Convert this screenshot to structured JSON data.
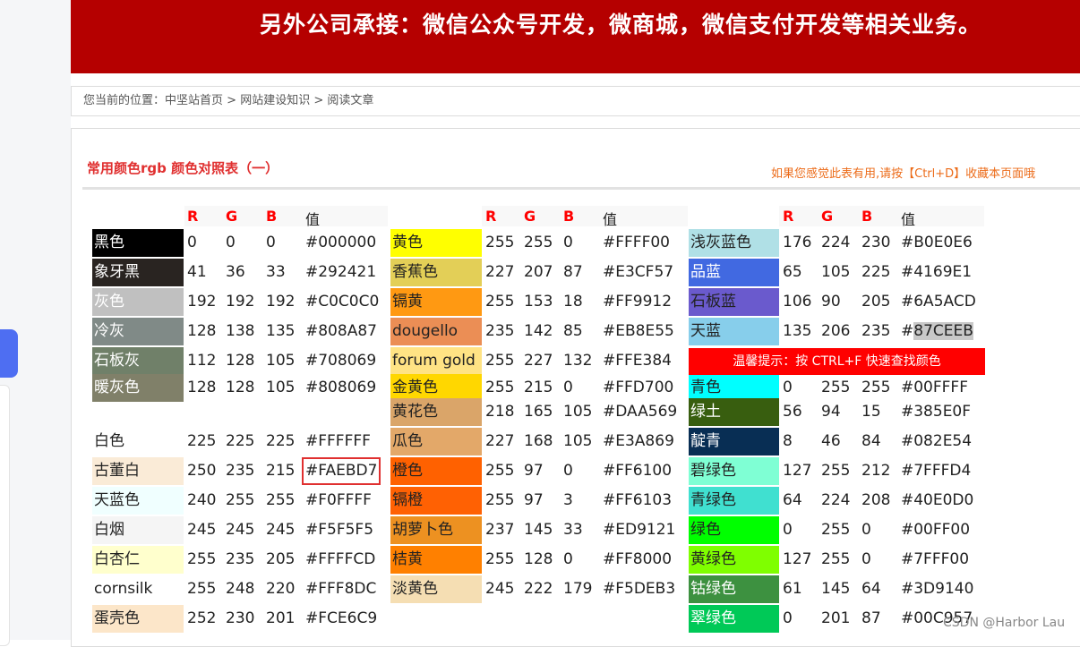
{
  "banner": {
    "text": "另外公司承接：微信公众号开发，微商城，微信支付开发等相关业务。"
  },
  "breadcrumb": {
    "prefix": "您当前的位置：",
    "home": "中坚站首页",
    "sep1": " > ",
    "category": "网站建设知识",
    "sep2": " > ",
    "current": "阅读文章"
  },
  "article": {
    "title": "常用颜色rgb 颜色对照表（一）",
    "bookmark_tip": "如果您感觉此表有用,请按【Ctrl+D】收藏本页面哦"
  },
  "table": {
    "headers": {
      "r": "R",
      "g": "G",
      "b": "B",
      "hex": "值"
    },
    "warm_tip": "温馨提示：按 CTRL+F 快速查找颜色",
    "col1": [
      {
        "name": "黑色",
        "r": "0",
        "g": "0",
        "b": "0",
        "hex": "#000000",
        "swatch": "#000000",
        "text_color": "#ffffff"
      },
      {
        "name": "象牙黑",
        "r": "41",
        "g": "36",
        "b": "33",
        "hex": "#292421",
        "swatch": "#292421",
        "text_color": "#ffffff"
      },
      {
        "name": "灰色",
        "r": "192",
        "g": "192",
        "b": "192",
        "hex": "#C0C0C0",
        "swatch": "#c0c0c0",
        "text_color": "#ffffff"
      },
      {
        "name": "冷灰",
        "r": "128",
        "g": "138",
        "b": "135",
        "hex": "#808A87",
        "swatch": "#808a87",
        "text_color": "#ffffff"
      },
      {
        "name": "石板灰",
        "r": "112",
        "g": "128",
        "b": "105",
        "hex": "#708069",
        "swatch": "#708069",
        "text_color": "#ffffff"
      },
      {
        "name": "暖灰色",
        "r": "128",
        "g": "128",
        "b": "105",
        "hex": "#808069",
        "swatch": "#808069",
        "text_color": "#ffffff"
      },
      {
        "name": "白色",
        "r": "225",
        "g": "225",
        "b": "225",
        "hex": "#FFFFFF",
        "swatch": "#ffffff",
        "text_color": "#222222"
      },
      {
        "name": "古董白",
        "r": "250",
        "g": "235",
        "b": "215",
        "hex": "#FAEBD7",
        "swatch": "#faebd7",
        "text_color": "#222222",
        "boxed": true
      },
      {
        "name": "天蓝色",
        "r": "240",
        "g": "255",
        "b": "255",
        "hex": "#F0FFFF",
        "swatch": "#f0ffff",
        "text_color": "#222222"
      },
      {
        "name": "白烟",
        "r": "245",
        "g": "245",
        "b": "245",
        "hex": "#F5F5F5",
        "swatch": "#f5f5f5",
        "text_color": "#222222"
      },
      {
        "name": "白杏仁",
        "r": "255",
        "g": "235",
        "b": "205",
        "hex": "#FFFFCD",
        "swatch": "#ffffcd",
        "text_color": "#222222"
      },
      {
        "name": "cornsilk",
        "r": "255",
        "g": "248",
        "b": "220",
        "hex": "#FFF8DC",
        "swatch": "#ffffff",
        "text_color": "#222222"
      },
      {
        "name": "蛋壳色",
        "r": "252",
        "g": "230",
        "b": "201",
        "hex": "#FCE6C9",
        "swatch": "#fce6c9",
        "text_color": "#222222"
      }
    ],
    "col2": [
      {
        "name": "黄色",
        "r": "255",
        "g": "255",
        "b": "0",
        "hex": "#FFFF00",
        "swatch": "#ffff00",
        "text_color": "#222222"
      },
      {
        "name": "香蕉色",
        "r": "227",
        "g": "207",
        "b": "87",
        "hex": "#E3CF57",
        "swatch": "#e3cf57",
        "text_color": "#222222"
      },
      {
        "name": "镉黄",
        "r": "255",
        "g": "153",
        "b": "18",
        "hex": "#FF9912",
        "swatch": "#ff9912",
        "text_color": "#222222"
      },
      {
        "name": "dougello",
        "r": "235",
        "g": "142",
        "b": "85",
        "hex": "#EB8E55",
        "swatch": "#eb8e55",
        "text_color": "#222222"
      },
      {
        "name": "forum gold",
        "r": "255",
        "g": "227",
        "b": "132",
        "hex": "#FFE384",
        "swatch": "#ffe384",
        "text_color": "#222222"
      },
      {
        "name": "金黄色",
        "r": "255",
        "g": "215",
        "b": "0",
        "hex": "#FFD700",
        "swatch": "#ffd700",
        "text_color": "#222222"
      },
      {
        "name": "黄花色",
        "r": "218",
        "g": "165",
        "b": "105",
        "hex": "#DAA569",
        "swatch": "#daa569",
        "text_color": "#222222"
      },
      {
        "name": "瓜色",
        "r": "227",
        "g": "168",
        "b": "105",
        "hex": "#E3A869",
        "swatch": "#e3a869",
        "text_color": "#222222"
      },
      {
        "name": "橙色",
        "r": "255",
        "g": "97",
        "b": "0",
        "hex": "#FF6100",
        "swatch": "#ff6100",
        "text_color": "#222222"
      },
      {
        "name": "镉橙",
        "r": "255",
        "g": "97",
        "b": "3",
        "hex": "#FF6103",
        "swatch": "#ff6103",
        "text_color": "#222222"
      },
      {
        "name": "胡萝卜色",
        "r": "237",
        "g": "145",
        "b": "33",
        "hex": "#ED9121",
        "swatch": "#ed9121",
        "text_color": "#222222"
      },
      {
        "name": "桔黄",
        "r": "255",
        "g": "128",
        "b": "0",
        "hex": "#FF8000",
        "swatch": "#ff8000",
        "text_color": "#222222"
      },
      {
        "name": "淡黄色",
        "r": "245",
        "g": "222",
        "b": "179",
        "hex": "#F5DEB3",
        "swatch": "#f5deb3",
        "text_color": "#222222"
      }
    ],
    "col3": [
      {
        "name": "浅灰蓝色",
        "r": "176",
        "g": "224",
        "b": "230",
        "hex": "#B0E0E6",
        "swatch": "#b0e0e6",
        "text_color": "#222222"
      },
      {
        "name": "品蓝",
        "r": "65",
        "g": "105",
        "b": "225",
        "hex": "#4169E1",
        "swatch": "#4169e1",
        "text_color": "#ffffff"
      },
      {
        "name": "石板蓝",
        "r": "106",
        "g": "90",
        "b": "205",
        "hex": "#6A5ACD",
        "swatch": "#6a5acd",
        "text_color": "#222222"
      },
      {
        "name": "天蓝",
        "r": "135",
        "g": "206",
        "b": "235",
        "hex_prefix": "#",
        "hex_rest": "87CEEB",
        "swatch": "#87ceeb",
        "text_color": "#222222"
      },
      {
        "name": "青色",
        "r": "0",
        "g": "255",
        "b": "255",
        "hex": "#00FFFF",
        "swatch": "#00ffff",
        "text_color": "#222222"
      },
      {
        "name": "绿土",
        "r": "56",
        "g": "94",
        "b": "15",
        "hex": "#385E0F",
        "swatch": "#385e0f",
        "text_color": "#ffffff"
      },
      {
        "name": "靛青",
        "r": "8",
        "g": "46",
        "b": "84",
        "hex": "#082E54",
        "swatch": "#082e54",
        "text_color": "#ffffff"
      },
      {
        "name": "碧绿色",
        "r": "127",
        "g": "255",
        "b": "212",
        "hex": "#7FFFD4",
        "swatch": "#7fffd4",
        "text_color": "#222222"
      },
      {
        "name": "青绿色",
        "r": "64",
        "g": "224",
        "b": "208",
        "hex": "#40E0D0",
        "swatch": "#40e0d0",
        "text_color": "#222222"
      },
      {
        "name": "绿色",
        "r": "0",
        "g": "255",
        "b": "0",
        "hex": "#00FF00",
        "swatch": "#00ff00",
        "text_color": "#222222"
      },
      {
        "name": "黄绿色",
        "r": "127",
        "g": "255",
        "b": "0",
        "hex": "#7FFF00",
        "swatch": "#7fff00",
        "text_color": "#222222"
      },
      {
        "name": "钴绿色",
        "r": "61",
        "g": "145",
        "b": "64",
        "hex": "#3D9140",
        "swatch": "#3d9140",
        "text_color": "#ffffff"
      },
      {
        "name": "翠绿色",
        "r": "0",
        "g": "201",
        "b": "87",
        "hex": "#00C957",
        "swatch": "#00c957",
        "text_color": "#ffffff"
      }
    ]
  },
  "watermark": "CSDN @Harbor Lau"
}
